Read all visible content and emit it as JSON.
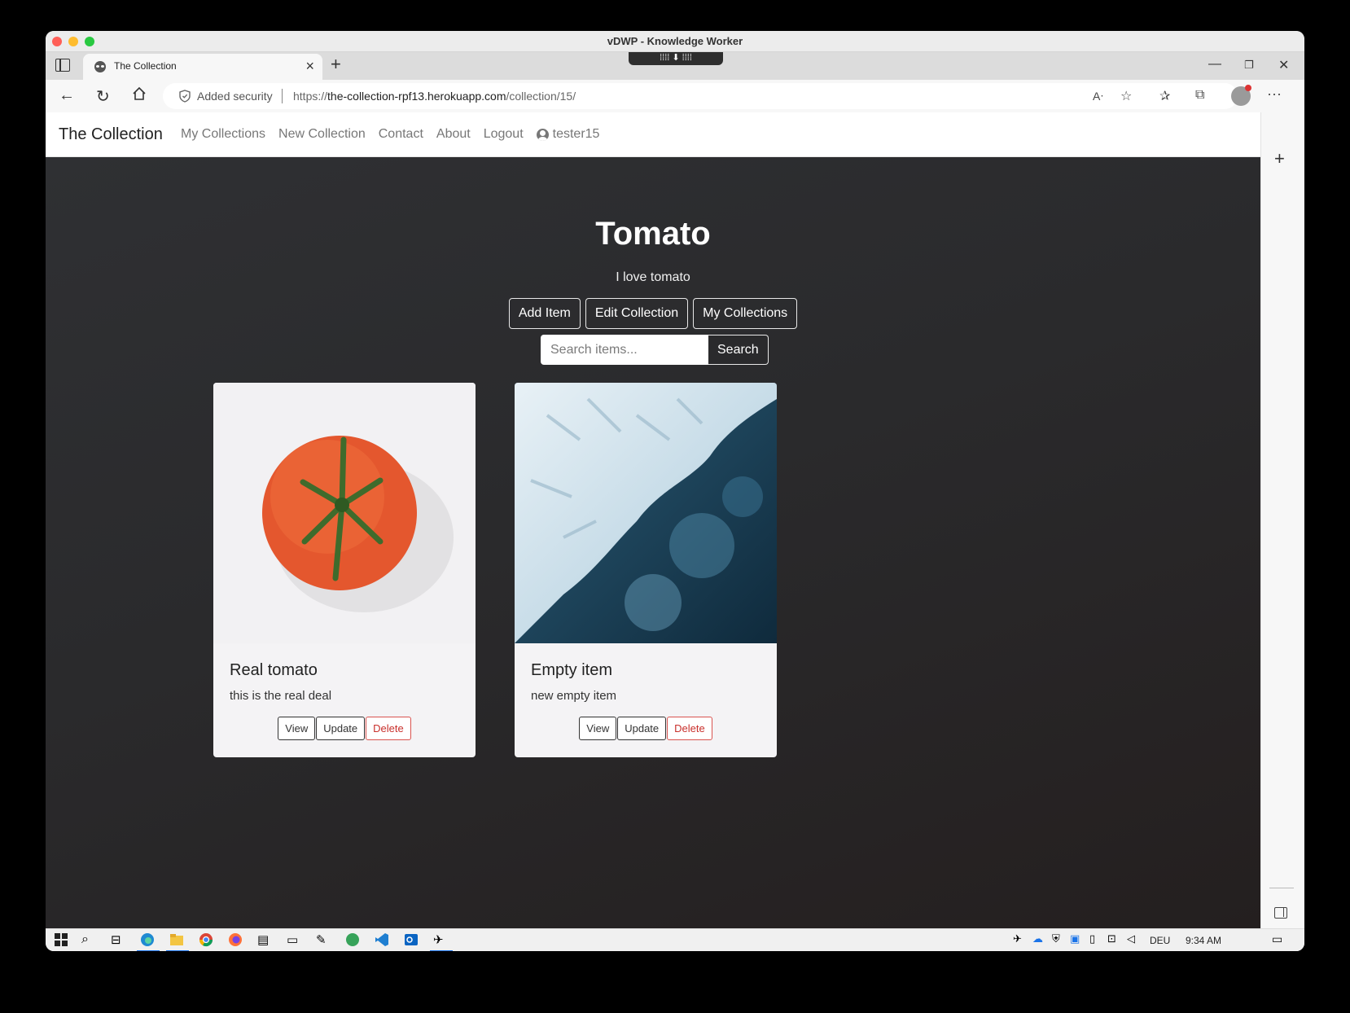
{
  "window": {
    "title": "vDWP - Knowledge Worker"
  },
  "browser": {
    "tab_title": "The Collection",
    "security_label": "Added security",
    "url_prefix": "https://",
    "url_host": "the-collection-rpf13.herokuapp.com",
    "url_path": "/collection/15/"
  },
  "site": {
    "brand": "The Collection",
    "nav": [
      "My Collections",
      "New Collection",
      "Contact",
      "About",
      "Logout"
    ],
    "username": "tester15"
  },
  "collection": {
    "title": "Tomato",
    "description": "I love tomato",
    "actions": [
      "Add Item",
      "Edit Collection",
      "My Collections"
    ],
    "search_placeholder": "Search items...",
    "search_button": "Search"
  },
  "items": [
    {
      "title": "Real tomato",
      "text": "this is the real deal",
      "image": "tomato-photo"
    },
    {
      "title": "Empty item",
      "text": "new empty item",
      "image": "glacier-aerial-photo"
    }
  ],
  "item_actions": {
    "view": "View",
    "update": "Update",
    "delete": "Delete"
  },
  "taskbar": {
    "language": "DEU",
    "time": "9:34 AM"
  }
}
